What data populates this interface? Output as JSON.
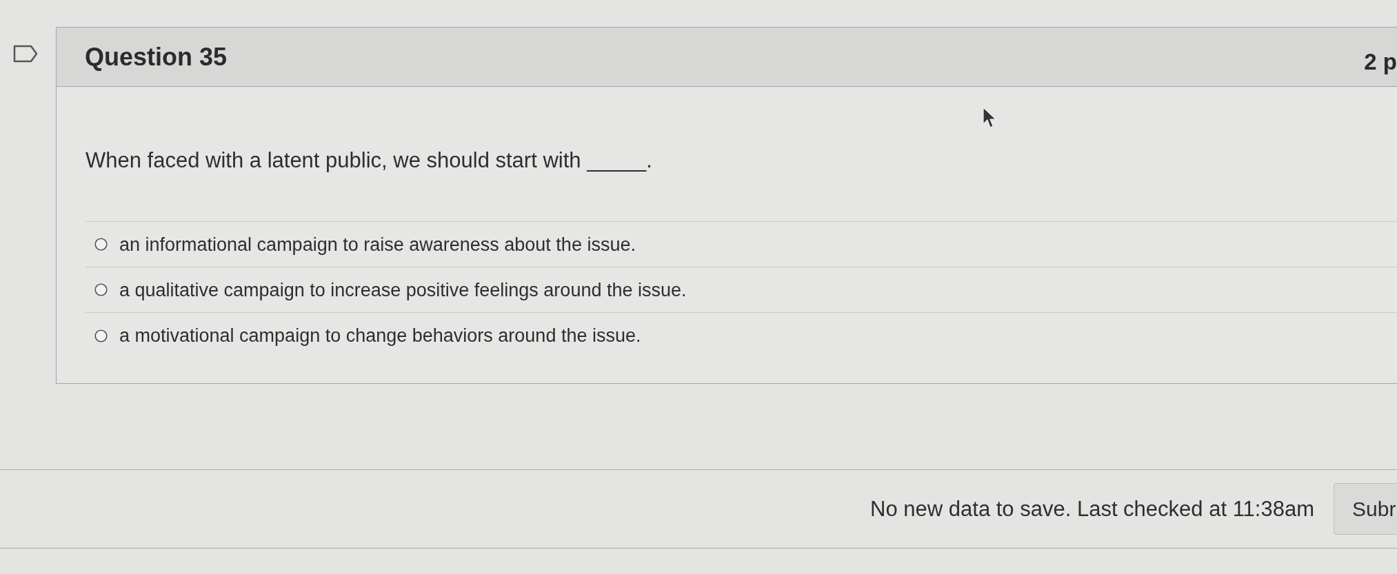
{
  "question": {
    "flagged": false,
    "title": "Question 35",
    "points": "2 p",
    "prompt": "When faced with a latent public, we should start with _____.",
    "options": [
      {
        "label": "an informational campaign to raise awareness about the issue.",
        "selected": false
      },
      {
        "label": "a qualitative campaign to increase positive feelings around the issue.",
        "selected": false
      },
      {
        "label": "a motivational campaign to change behaviors around the issue.",
        "selected": false
      }
    ]
  },
  "footer": {
    "status": "No new data to save. Last checked at 11:38am",
    "submit_button": "Subr"
  }
}
